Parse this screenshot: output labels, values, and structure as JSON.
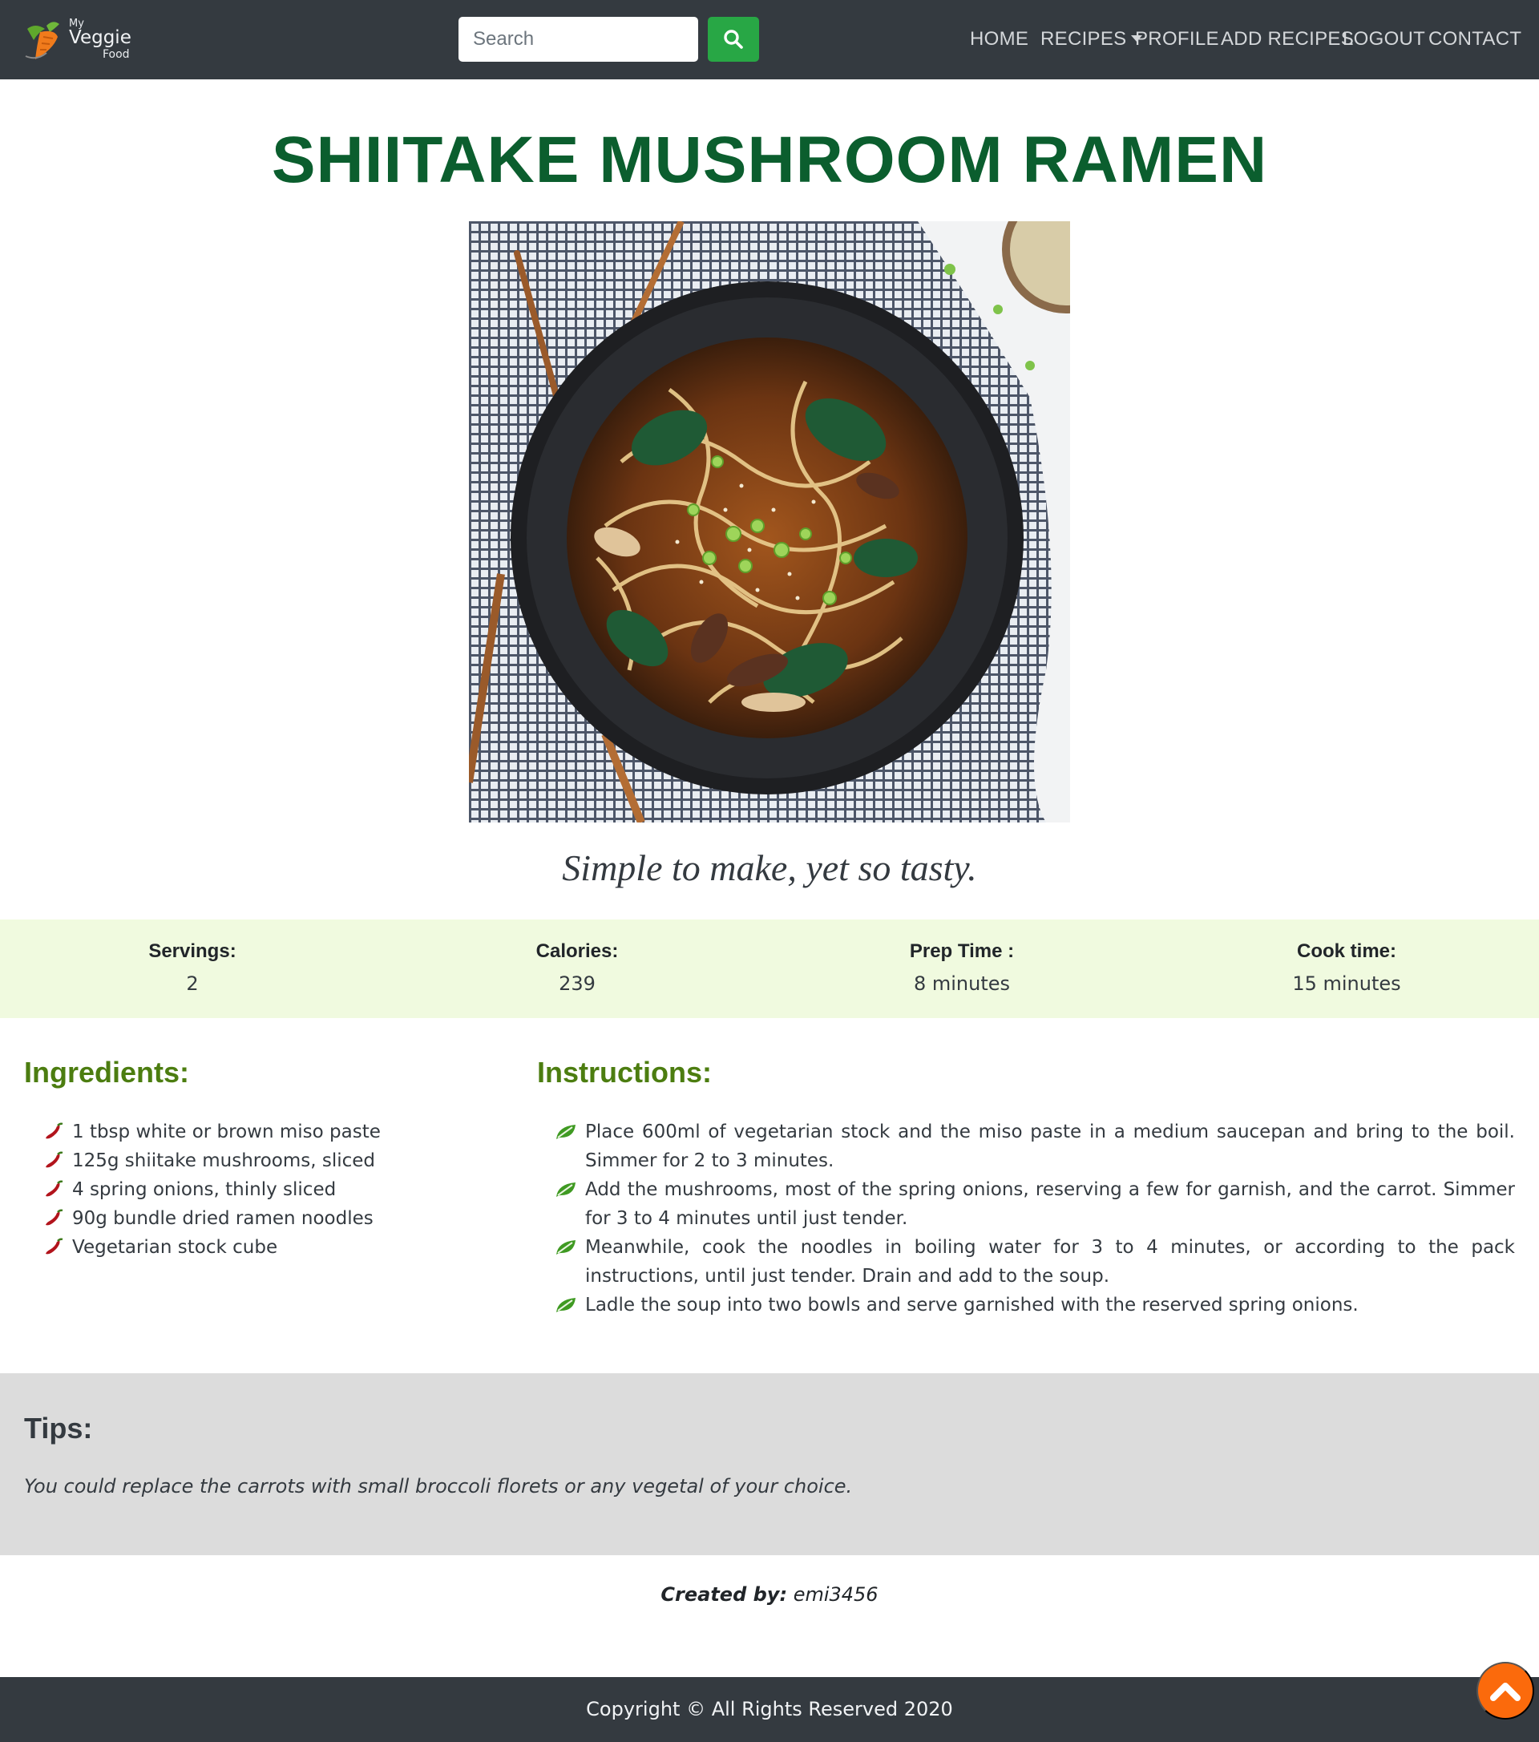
{
  "brand": {
    "logo_line1": "My",
    "logo_line2": "Veggie",
    "logo_line3": "Food"
  },
  "search": {
    "placeholder": "Search"
  },
  "nav": {
    "home": "HOME",
    "recipes": "RECIPES",
    "profile": "PROFILE",
    "add_recipes": "ADD RECIPES",
    "logout": "LOGOUT",
    "contact": "CONTACT"
  },
  "recipe": {
    "title": "SHIITAKE MUSHROOM RAMEN",
    "tagline": "Simple to make, yet so tasty."
  },
  "stats": {
    "servings_label": "Servings:",
    "servings_value": "2",
    "calories_label": "Calories:",
    "calories_value": "239",
    "prep_label": "Prep Time :",
    "prep_value": "8 minutes",
    "cook_label": "Cook time:",
    "cook_value": "15 minutes"
  },
  "ingredients": {
    "heading": "Ingredients:",
    "items": [
      "1 tbsp white or brown miso paste",
      "125g shiitake mushrooms, sliced",
      "4 spring onions, thinly sliced",
      "90g bundle dried ramen noodles",
      "Vegetarian stock cube"
    ]
  },
  "instructions": {
    "heading": "Instructions:",
    "steps": [
      "Place 600ml of vegetarian stock and the miso paste in a medium saucepan and bring to the boil. Simmer for 2 to 3 minutes.",
      "Add the mushrooms, most of the spring onions, reserving a few for garnish, and the carrot. Simmer for 3 to 4 minutes until just tender.",
      "Meanwhile, cook the noodles in boiling water for 3 to 4 minutes, or according to the pack instructions, until just tender. Drain and add to the soup.",
      "Ladle the soup into two bowls and serve garnished with the reserved spring onions."
    ]
  },
  "tips": {
    "heading": "Tips:",
    "text": "You could replace the carrots with small broccoli florets or any vegetal of your choice."
  },
  "created": {
    "label": "Created by:",
    "author": "emi3456"
  },
  "footer": {
    "copyright": "Copyright © All Rights Reserved 2020"
  },
  "icons": {
    "search": "search-icon",
    "ingredient_bullet": "chili-pepper-icon",
    "instruction_bullet": "leaf-icon",
    "back_to_top": "chevron-up-icon"
  },
  "colors": {
    "navbar": "#343a40",
    "title": "#0b5e2e",
    "section_heading": "#4c7d10",
    "search_button": "#28a745",
    "stats_band": "#f0fadf",
    "tips_band": "#dcdcdc",
    "back_to_top": "#fb6a0c"
  }
}
